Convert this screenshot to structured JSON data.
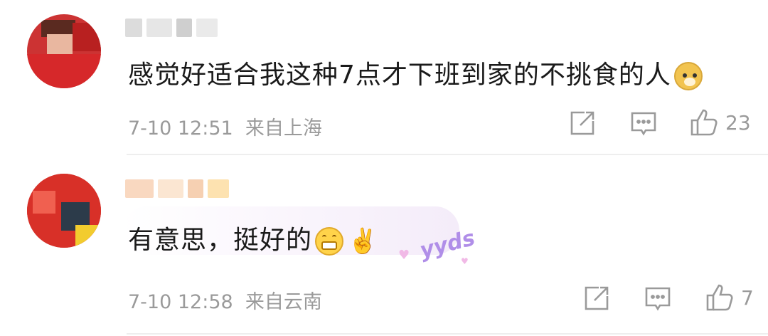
{
  "comments": [
    {
      "text": "感觉好适合我这种7点才下班到家的不挑食的人",
      "emoji": "doge-emoji",
      "timestamp": "7-10 12:51",
      "location": "来自上海",
      "like_count": "23"
    },
    {
      "text": "有意思，挺好的",
      "emoji": "grin-emoji",
      "emoji_victory": "✌️",
      "decoration": "yyds",
      "timestamp": "7-10 12:58",
      "location": "来自云南",
      "like_count": "7"
    }
  ],
  "icons": {
    "share": "share-icon",
    "reply": "comment-icon",
    "like": "thumbs-up-icon"
  },
  "colors": {
    "meta": "#9a9a9a",
    "text": "#1a1a1a",
    "divider": "#eeeeee"
  }
}
